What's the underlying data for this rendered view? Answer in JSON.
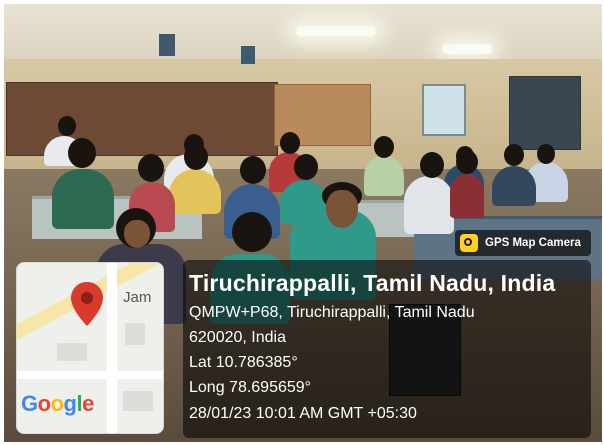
{
  "photo": {
    "scene": "classroom",
    "colors": {
      "wall": "#c7b48c",
      "floor": "#5a4c3c",
      "shirt_teal": "#2f9a8a",
      "shirt_white": "#dfe3e6"
    }
  },
  "gps_badge": {
    "label": "GPS Map Camera",
    "icon": "camera-icon",
    "accent": "#ffd21f"
  },
  "location": {
    "city_line": "Tiruchirappalli, Tamil Nadu, India",
    "address_line_1": "QMPW+P68, Tiruchirappalli, Tamil Nadu",
    "address_line_2": "620020, India",
    "lat": "Lat 10.786385°",
    "long": "Long 78.695659°",
    "datetime": "28/01/23 10:01 AM GMT +05:30"
  },
  "map": {
    "label": "Jam",
    "pin_icon": "map-pin-icon",
    "pin_color": "#d93a2c",
    "logo": "Google"
  }
}
